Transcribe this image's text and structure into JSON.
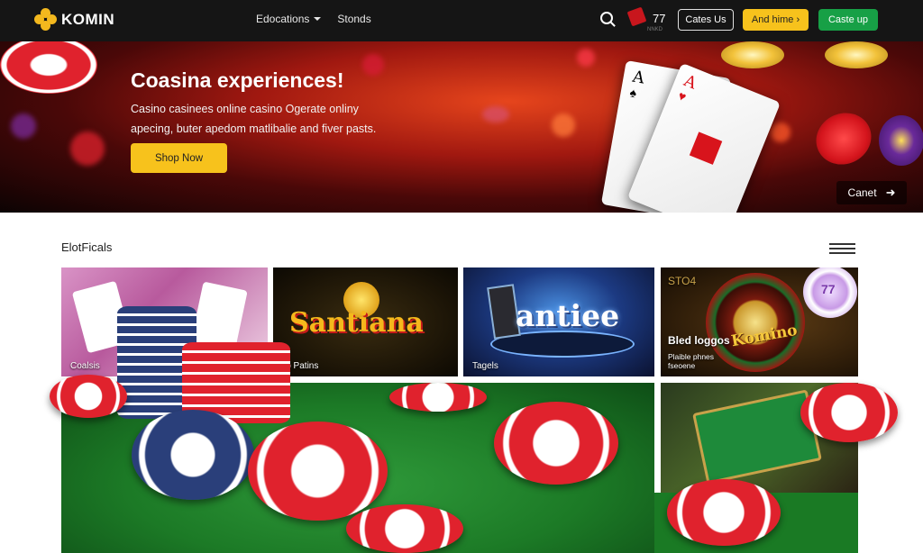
{
  "nav": {
    "logo": "KOMIN",
    "links": [
      {
        "label": "Edocations",
        "has_dropdown": true
      },
      {
        "label": "Stonds",
        "has_dropdown": false
      }
    ],
    "cart_count": "77",
    "cart_sub": "NNKD",
    "buttons": {
      "contact": "Cates Us",
      "add": "And hime",
      "cta": "Caste up"
    }
  },
  "hero": {
    "title": "Coasina experiences!",
    "subtitle": "Casino casinees online casino Ogerate onliny apecing, buter apedom matlibalie and fiver pasts.",
    "shop_button": "Shop Now",
    "cancel_link": "Canet",
    "card_a_rank": "A",
    "card_b_rank": "A"
  },
  "section": {
    "title": "ElotFicals",
    "tiles": [
      {
        "label": "Coalsis"
      },
      {
        "label": "lp Patins",
        "art_text": "Santiana"
      },
      {
        "label": "Tagels",
        "art_text": "antiee"
      },
      {
        "label": "Bled loggos",
        "label2": "Plaible phnes fseoene",
        "corner": "STO4",
        "art_text": "Komino",
        "chip_text": "77"
      }
    ]
  },
  "colors": {
    "accent_yellow": "#f7c21c",
    "accent_green": "#17a046",
    "nav_bg": "#151515",
    "chip_red": "#e0222d",
    "felt_green": "#1c7a26"
  },
  "icons": [
    "logo-icon",
    "search-icon",
    "cart-icon",
    "chevron-down-icon",
    "arrow-right-icon",
    "menu-icon"
  ]
}
